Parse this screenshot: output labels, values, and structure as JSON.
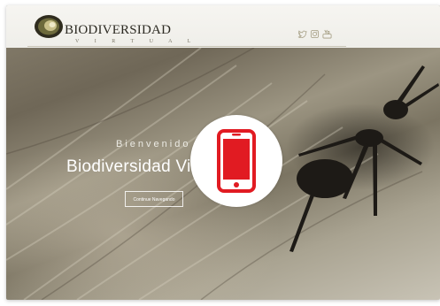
{
  "header": {
    "brand_name": "BIODIVERSIDAD",
    "brand_sub": "V I R T U A L",
    "social_icons": [
      "twitter-icon",
      "instagram-icon",
      "youtube-icon"
    ]
  },
  "hero": {
    "greeting": "Bienvenido a",
    "headline": "Biodiversidad Virtual",
    "cta_label": "Continue Navegando"
  },
  "overlay": {
    "icon": "smartphone-icon",
    "accent_color": "#e11b22"
  },
  "colors": {
    "header_bg": "#f4f3ef",
    "brand_text": "#2c2a22",
    "hero_text": "#ffffff"
  }
}
